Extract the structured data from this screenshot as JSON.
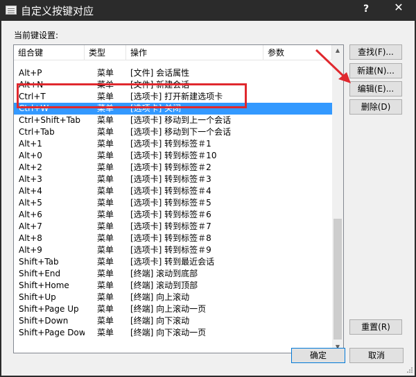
{
  "window": {
    "title": "自定义按键对应",
    "help_label": "?",
    "close_label": "✕",
    "icon": "keyboard-icon"
  },
  "section_label": "当前键设置:",
  "columns": [
    "组合键",
    "类型",
    "操作",
    "参数"
  ],
  "rows": [
    {
      "key": "Alt+P",
      "type": "菜单",
      "action": "[文件] 会话属性",
      "param": ""
    },
    {
      "key": "Alt+N",
      "type": "菜单",
      "action": "[文件] 新建会话",
      "param": ""
    },
    {
      "key": "Ctrl+T",
      "type": "菜单",
      "action": "[选项卡] 打开新建选项卡",
      "param": ""
    },
    {
      "key": "Ctrl+W",
      "type": "菜单",
      "action": "[选项卡] 关闭",
      "param": ""
    },
    {
      "key": "Ctrl+Shift+Tab",
      "type": "菜单",
      "action": "[选项卡] 移动到上一个会话",
      "param": ""
    },
    {
      "key": "Ctrl+Tab",
      "type": "菜单",
      "action": "[选项卡] 移动到下一个会话",
      "param": ""
    },
    {
      "key": "Alt+1",
      "type": "菜单",
      "action": "[选项卡] 转到标签＃1",
      "param": ""
    },
    {
      "key": "Alt+0",
      "type": "菜单",
      "action": "[选项卡] 转到标签＃10",
      "param": ""
    },
    {
      "key": "Alt+2",
      "type": "菜单",
      "action": "[选项卡] 转到标签＃2",
      "param": ""
    },
    {
      "key": "Alt+3",
      "type": "菜单",
      "action": "[选项卡] 转到标签＃3",
      "param": ""
    },
    {
      "key": "Alt+4",
      "type": "菜单",
      "action": "[选项卡] 转到标签＃4",
      "param": ""
    },
    {
      "key": "Alt+5",
      "type": "菜单",
      "action": "[选项卡] 转到标签＃5",
      "param": ""
    },
    {
      "key": "Alt+6",
      "type": "菜单",
      "action": "[选项卡] 转到标签＃6",
      "param": ""
    },
    {
      "key": "Alt+7",
      "type": "菜单",
      "action": "[选项卡] 转到标签＃7",
      "param": ""
    },
    {
      "key": "Alt+8",
      "type": "菜单",
      "action": "[选项卡] 转到标签＃8",
      "param": ""
    },
    {
      "key": "Alt+9",
      "type": "菜单",
      "action": "[选项卡] 转到标签＃9",
      "param": ""
    },
    {
      "key": "Shift+Tab",
      "type": "菜单",
      "action": "[选项卡] 转到最近会话",
      "param": ""
    },
    {
      "key": "Shift+End",
      "type": "菜单",
      "action": "[终端] 滚动到底部",
      "param": ""
    },
    {
      "key": "Shift+Home",
      "type": "菜单",
      "action": "[终端] 滚动到顶部",
      "param": ""
    },
    {
      "key": "Shift+Up",
      "type": "菜单",
      "action": "[终端] 向上滚动",
      "param": ""
    },
    {
      "key": "Shift+Page Up",
      "type": "菜单",
      "action": "[终端] 向上滚动一页",
      "param": ""
    },
    {
      "key": "Shift+Down",
      "type": "菜单",
      "action": "[终端] 向下滚动",
      "param": ""
    },
    {
      "key": "Shift+Page Down",
      "type": "菜单",
      "action": "[终端] 向下滚动一页",
      "param": ""
    }
  ],
  "buttons": {
    "find": "查找(F)...",
    "new": "新建(N)...",
    "edit": "编辑(E)...",
    "delete": "删除(D)",
    "reset": "重置(R)",
    "ok": "确定",
    "cancel": "取消"
  },
  "colors": {
    "selection": "#3399ff",
    "annotation": "#e0282e"
  }
}
